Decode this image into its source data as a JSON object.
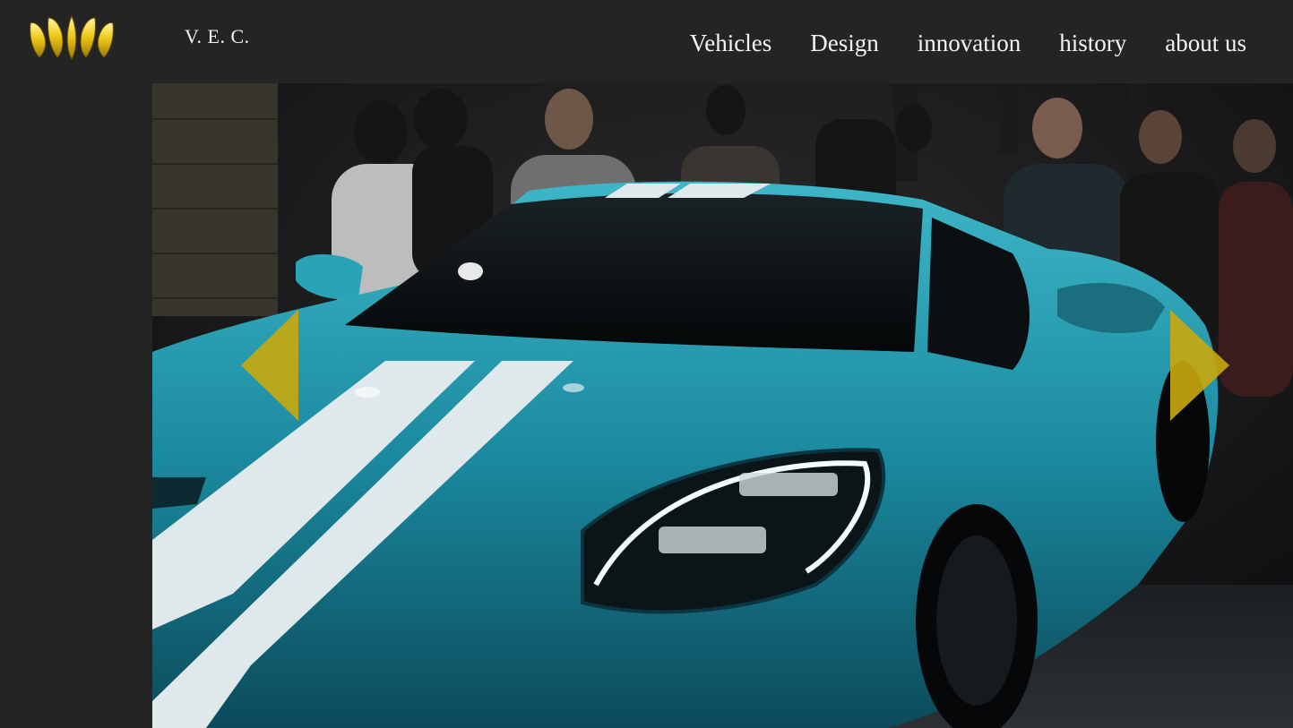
{
  "header": {
    "brand": "V. E. C.",
    "logo_icon": "golden-crown-icon",
    "accent_color": "#d9b210"
  },
  "nav": {
    "items": [
      {
        "label": "Vehicles"
      },
      {
        "label": "Design"
      },
      {
        "label": "innovation"
      },
      {
        "label": "history"
      },
      {
        "label": "about us"
      }
    ]
  },
  "carousel": {
    "slide_subject": "blue sports car with white racing stripes at auto show",
    "prev_icon": "triangle-left-icon",
    "next_icon": "triangle-right-icon"
  },
  "colors": {
    "background": "#242424",
    "car_body": "#1e8fa3",
    "stripe": "#dfe8ea",
    "arrow": "#c9a80d"
  }
}
